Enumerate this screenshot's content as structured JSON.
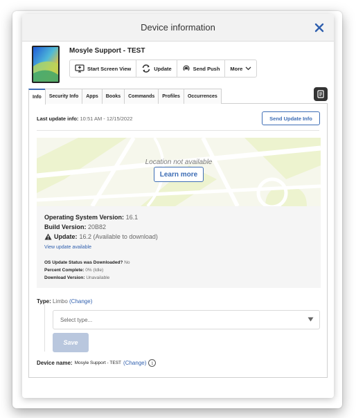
{
  "window": {
    "title": "Device information"
  },
  "device": {
    "name": "Mosyle Support - TEST"
  },
  "toolbar": {
    "start_screen_view": "Start Screen View",
    "update": "Update",
    "send_push": "Send Push",
    "more": "More"
  },
  "tabs": [
    "Info",
    "Security Info",
    "Apps",
    "Books",
    "Commands",
    "Profiles",
    "Occurrences"
  ],
  "info": {
    "last_update_label": "Last update info:",
    "last_update_value": "10:51 AM - 12/15/2022",
    "send_update_info": "Send Update Info",
    "location_not_available": "Location not available",
    "learn_more": "Learn more",
    "os_version_label": "Operating System Version:",
    "os_version_value": "16.1",
    "build_version_label": "Build Version:",
    "build_version_value": "20B82",
    "update_label": "Update:",
    "update_value": "16.2 (Available to download)",
    "view_update_available": "View update available",
    "os_update_status_label": "OS Update Status was Downloaded?",
    "os_update_status_value": "No",
    "percent_complete_label": "Percent Complete:",
    "percent_complete_value": "0% (Idle)",
    "download_version_label": "Download Version:",
    "download_version_value": "Unavailable",
    "type_label": "Type:",
    "type_value": "Limbo",
    "change_link": "(Change)",
    "select_placeholder": "Select type...",
    "save": "Save",
    "device_name_label": "Device name:",
    "device_name_value": "Mosyle Support - TEST",
    "info_icon_glyph": "i"
  },
  "colors": {
    "accent": "#3d6db5",
    "link": "#2f5fae",
    "save_disabled": "#b9c7de",
    "header_bg": "#f2f2f2"
  },
  "icons": [
    "close-icon",
    "monitor-icon",
    "refresh-icon",
    "broadcast-icon",
    "chevron-down-icon",
    "notes-icon",
    "warning-icon",
    "info-icon"
  ]
}
